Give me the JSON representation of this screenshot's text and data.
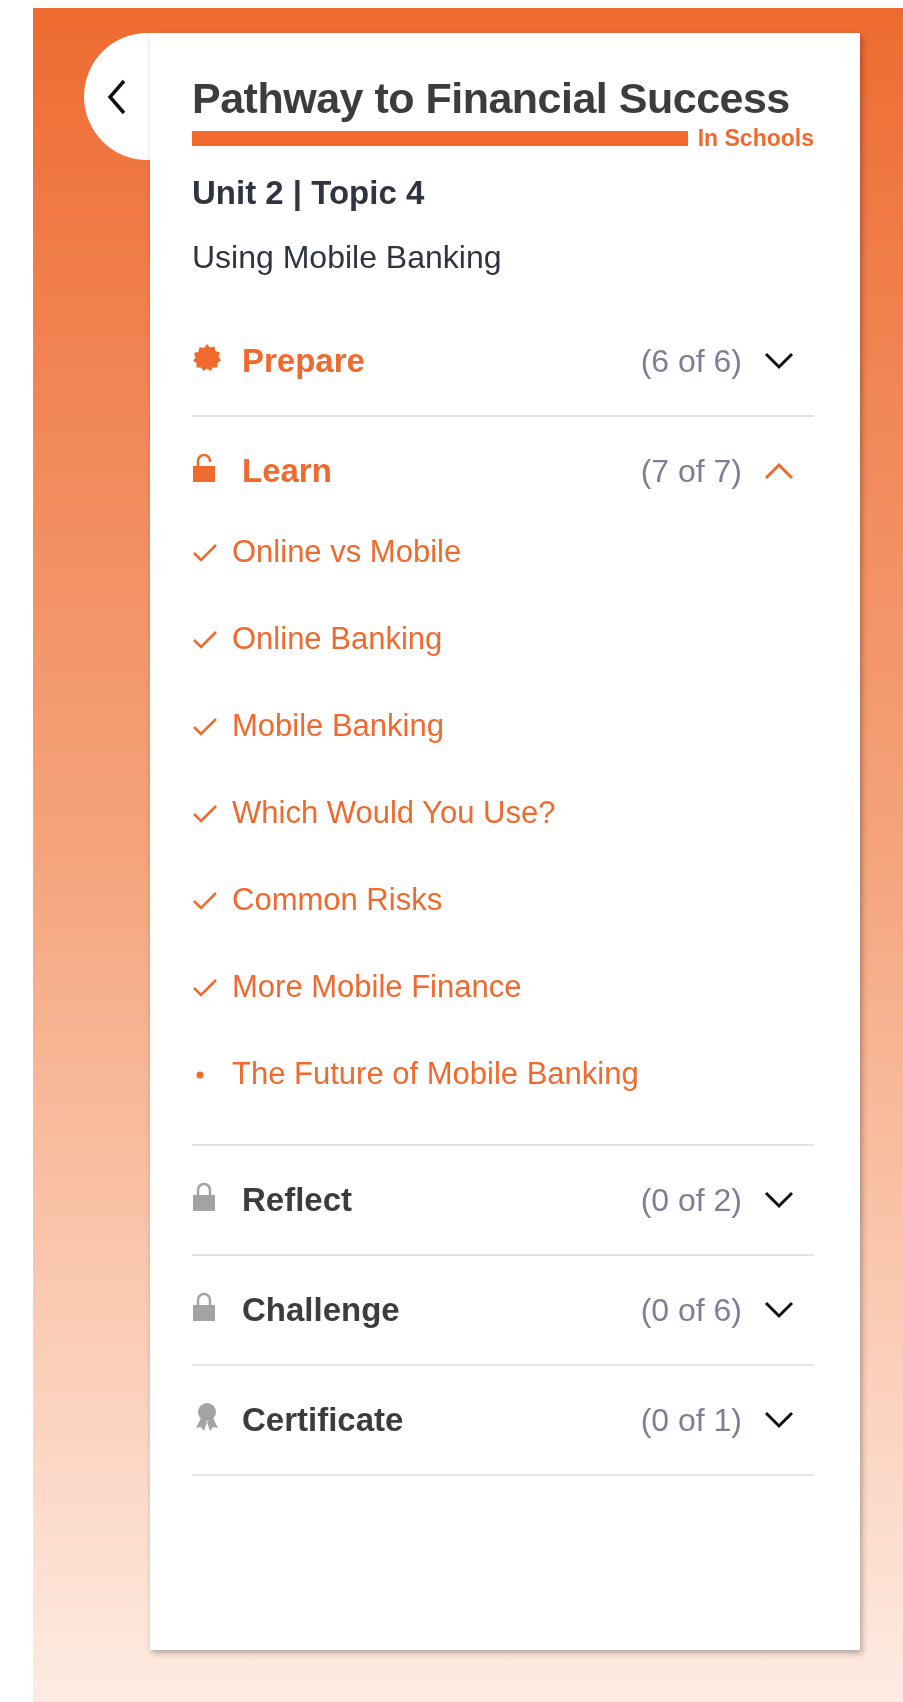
{
  "brand": {
    "title": "Pathway to Financial Success",
    "subtitle": "In Schools"
  },
  "heading": "Unit 2 | Topic 4",
  "topic": "Using Mobile Banking",
  "sections": [
    {
      "title": "Prepare",
      "kind": "badge",
      "locked": false,
      "count": "(6 of 6)",
      "expanded": false
    },
    {
      "title": "Learn",
      "kind": "lock",
      "locked": false,
      "count": "(7 of 7)",
      "expanded": true,
      "items": [
        {
          "label": "Online vs Mobile",
          "done": true
        },
        {
          "label": "Online Banking",
          "done": true
        },
        {
          "label": "Mobile Banking",
          "done": true
        },
        {
          "label": "Which Would You Use?",
          "done": true
        },
        {
          "label": "Common Risks",
          "done": true
        },
        {
          "label": "More Mobile Finance",
          "done": true
        },
        {
          "label": "The Future of Mobile Banking",
          "done": false
        }
      ]
    },
    {
      "title": "Reflect",
      "kind": "lock",
      "locked": true,
      "count": "(0 of 2)",
      "expanded": false
    },
    {
      "title": "Challenge",
      "kind": "lock",
      "locked": true,
      "count": "(0 of 6)",
      "expanded": false
    },
    {
      "title": "Certificate",
      "kind": "award",
      "locked": true,
      "count": "(0 of 1)",
      "expanded": false
    }
  ]
}
